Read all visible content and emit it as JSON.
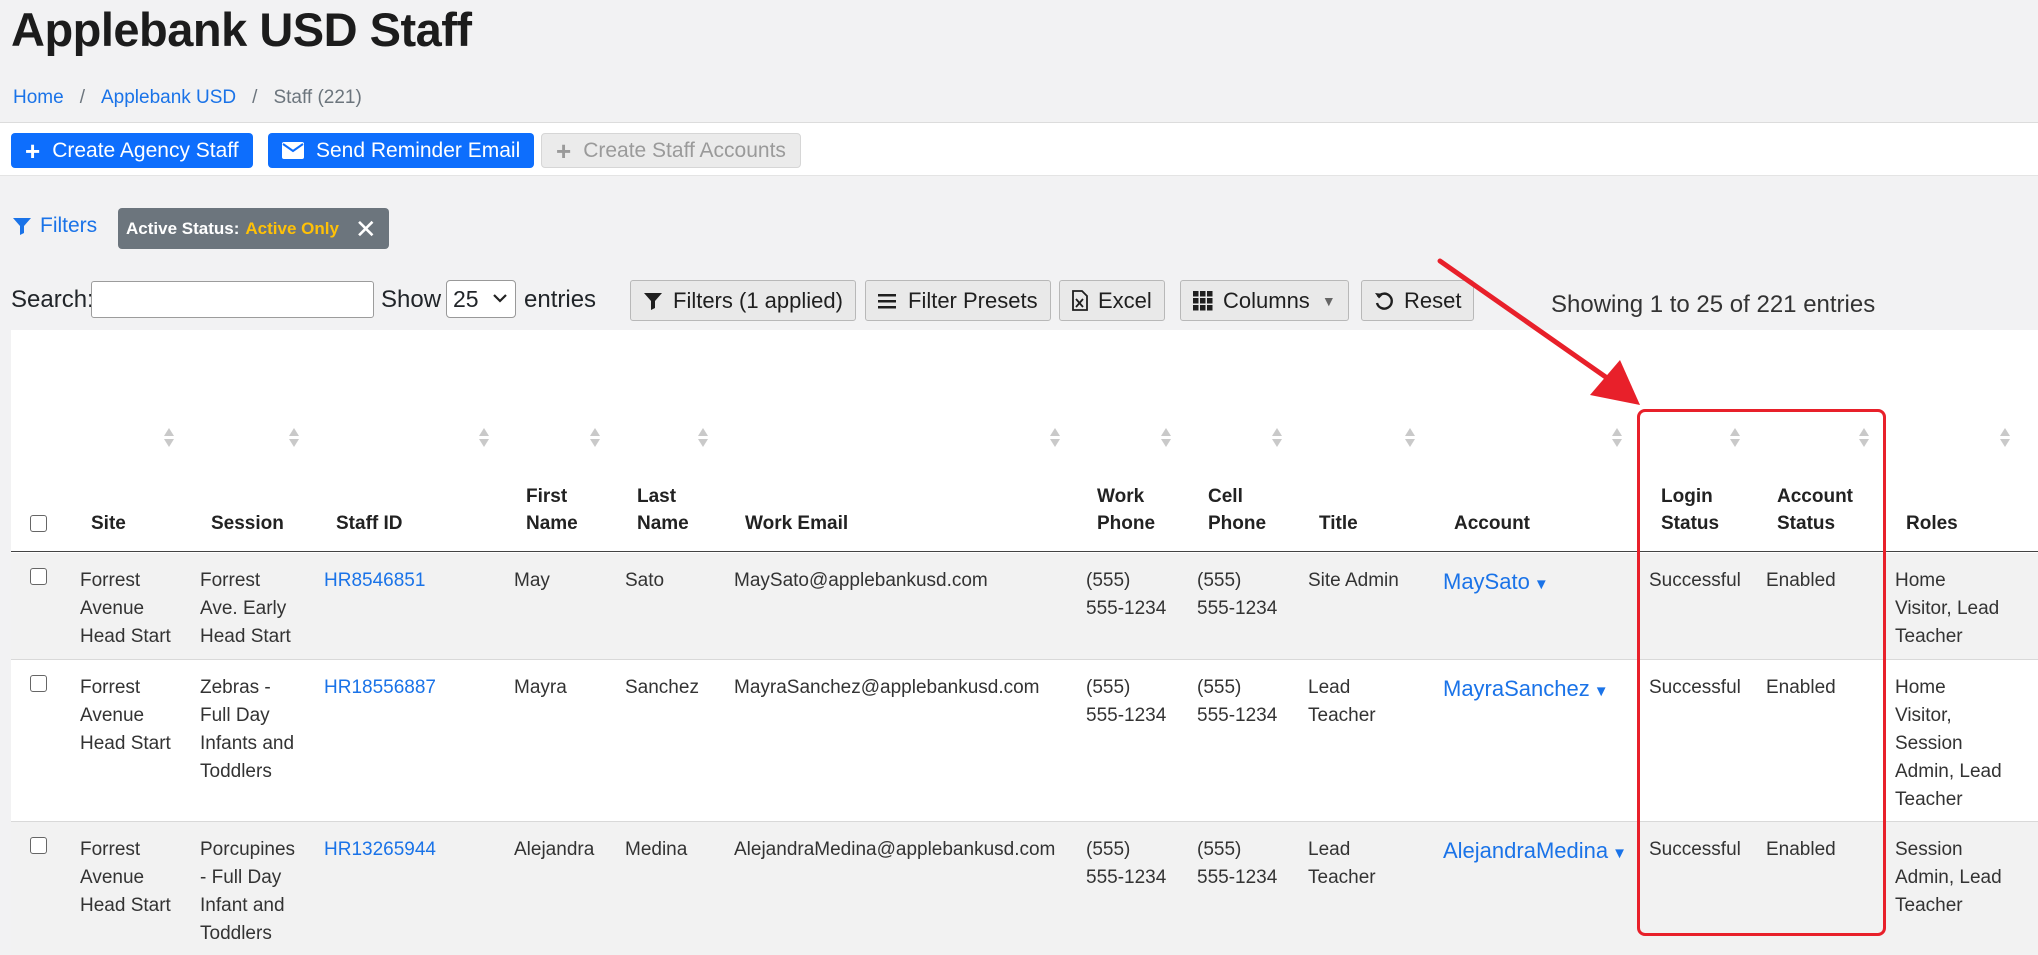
{
  "page": {
    "title": "Applebank USD Staff",
    "breadcrumb": {
      "home": "Home",
      "agency": "Applebank USD",
      "current": "Staff (221)"
    }
  },
  "toolbar": {
    "create_agency_staff": "Create Agency Staff",
    "send_reminder_email": "Send Reminder Email",
    "create_staff_accounts": "Create Staff Accounts"
  },
  "filters": {
    "link_label": "Filters",
    "chip_label": "Active Status:",
    "chip_value": "Active Only"
  },
  "datatable": {
    "search_label": "Search:",
    "search_value": "",
    "show_label": "Show",
    "page_length": "25",
    "entries_label": "entries",
    "buttons": {
      "filters": "Filters (1 applied)",
      "filter_presets": "Filter Presets",
      "excel": "Excel",
      "columns": "Columns",
      "reset": "Reset"
    },
    "info": "Showing 1 to 25 of 221 entries"
  },
  "columns": {
    "site": "Site",
    "session": "Session",
    "staff_id": "Staff ID",
    "first_name_1": "First",
    "first_name_2": "Name",
    "last_name_1": "Last",
    "last_name_2": "Name",
    "work_email": "Work Email",
    "work_phone_1": "Work",
    "work_phone_2": "Phone",
    "cell_phone_1": "Cell",
    "cell_phone_2": "Phone",
    "title": "Title",
    "account": "Account",
    "login_status_1": "Login",
    "login_status_2": "Status",
    "account_status_1": "Account",
    "account_status_2": "Status",
    "roles": "Roles"
  },
  "rows": [
    {
      "site": [
        "Forrest",
        "Avenue",
        "Head Start"
      ],
      "session": [
        "Forrest",
        "Ave. Early",
        "Head Start"
      ],
      "staff_id": "HR8546851",
      "first_name": "May",
      "last_name": "Sato",
      "work_email": "MaySato@applebankusd.com",
      "work_phone": [
        "(555)",
        "555-1234"
      ],
      "cell_phone": [
        "(555)",
        "555-1234"
      ],
      "title": [
        "Site Admin"
      ],
      "account": "MaySato",
      "login_status": "Successful",
      "account_status": "Enabled",
      "roles": [
        "Home",
        "Visitor, Lead",
        "Teacher"
      ]
    },
    {
      "site": [
        "Forrest",
        "Avenue",
        "Head Start"
      ],
      "session": [
        "Zebras -",
        "Full Day",
        "Infants and",
        "Toddlers"
      ],
      "staff_id": "HR18556887",
      "first_name": "Mayra",
      "last_name": "Sanchez",
      "work_email": "MayraSanchez@applebankusd.com",
      "work_phone": [
        "(555)",
        "555-1234"
      ],
      "cell_phone": [
        "(555)",
        "555-1234"
      ],
      "title": [
        "Lead",
        "Teacher"
      ],
      "account": "MayraSanchez",
      "login_status": "Successful",
      "account_status": "Enabled",
      "roles": [
        "Home",
        "Visitor,",
        "Session",
        "Admin, Lead",
        "Teacher"
      ]
    },
    {
      "site": [
        "Forrest",
        "Avenue",
        "Head Start"
      ],
      "session": [
        "Porcupines",
        "- Full Day",
        "Infant and",
        "Toddlers"
      ],
      "staff_id": "HR13265944",
      "first_name": "Alejandra",
      "last_name": "Medina",
      "work_email": "AlejandraMedina@applebankusd.com",
      "work_phone": [
        "(555)",
        "555-1234"
      ],
      "cell_phone": [
        "(555)",
        "555-1234"
      ],
      "title": [
        "Lead",
        "Teacher"
      ],
      "account": "AlejandraMedina",
      "login_status": "Successful",
      "account_status": "Enabled",
      "roles": [
        "Session",
        "Admin, Lead",
        "Teacher"
      ]
    }
  ],
  "annotation": {
    "color": "#e8202a"
  }
}
